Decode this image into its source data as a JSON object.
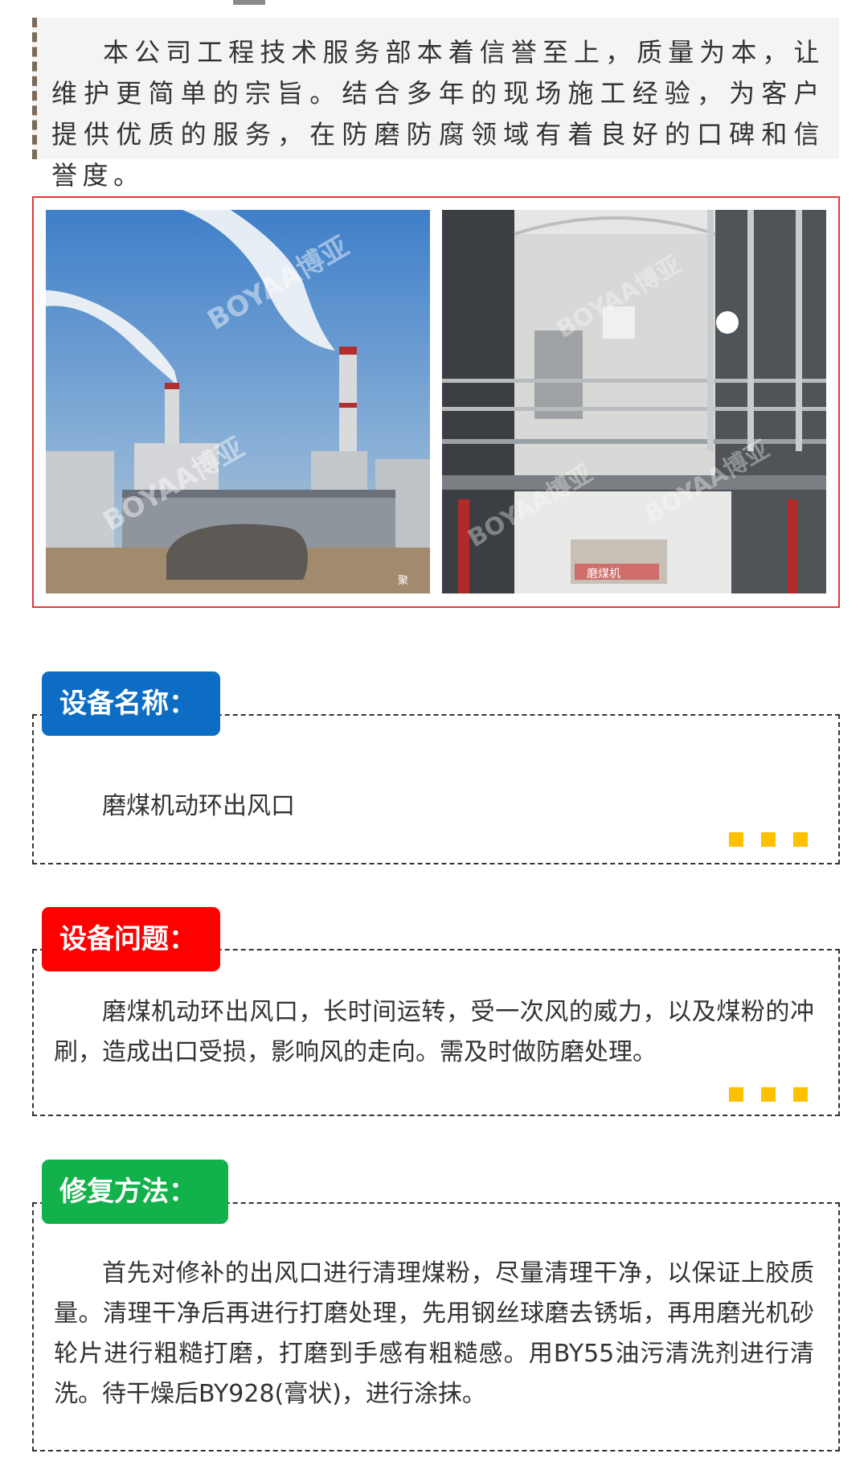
{
  "intro": {
    "text": "本公司工程技术服务部本着信誉至上，质量为本，让维护更简单的宗旨。结合多年的现场施工经验，为客户提供优质的服务，在防磨防腐领域有着良好的口碑和信誉度。"
  },
  "photos": {
    "left": {
      "watermark": "BOYAA博亚",
      "caption": "聚"
    },
    "right": {
      "watermark": "BOYAA博亚",
      "sign": "磨煤机"
    }
  },
  "sections": [
    {
      "tag": "设备名称：",
      "color": "#0d6dc4",
      "text": "磨煤机动环出风口"
    },
    {
      "tag": "设备问题：",
      "color": "#ff0000",
      "text": "磨煤机动环出风口，长时间运转，受一次风的威力，以及煤粉的冲刷，造成出口受损，影响风的走向。需及时做防磨处理。"
    },
    {
      "tag": "修复方法：",
      "color": "#13b14b",
      "text": "首先对修补的出风口进行清理煤粉，尽量清理干净，以保证上胶质量。清理干净后再进行打磨处理，先用钢丝球磨去锈垢，再用磨光机砂轮片进行粗糙打磨，打磨到手感有粗糙感。用BY55油污清洗剂进行清洗。待干燥后BY928(膏状)，进行涂抹。"
    }
  ],
  "dot_color": "#ffc000",
  "frame_color": "#e23a3a"
}
